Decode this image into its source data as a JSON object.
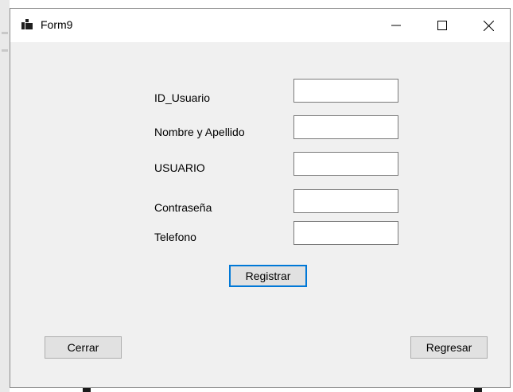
{
  "window": {
    "title": "Form9",
    "icon": "windows-forms-app-icon",
    "controls": [
      "minimize-icon",
      "maximize-icon",
      "close-icon"
    ]
  },
  "form": {
    "fields": [
      {
        "label": "ID_Usuario",
        "value": ""
      },
      {
        "label": "Nombre y Apellido",
        "value": ""
      },
      {
        "label": "USUARIO",
        "value": ""
      },
      {
        "label": "Contraseña",
        "value": ""
      },
      {
        "label": "Telefono",
        "value": ""
      }
    ],
    "register_label": "Registrar"
  },
  "footer": {
    "close_label": "Cerrar",
    "back_label": "Regresar"
  },
  "colors": {
    "form_background": "#f0f0f0",
    "default_button_border": "#0078d7"
  }
}
